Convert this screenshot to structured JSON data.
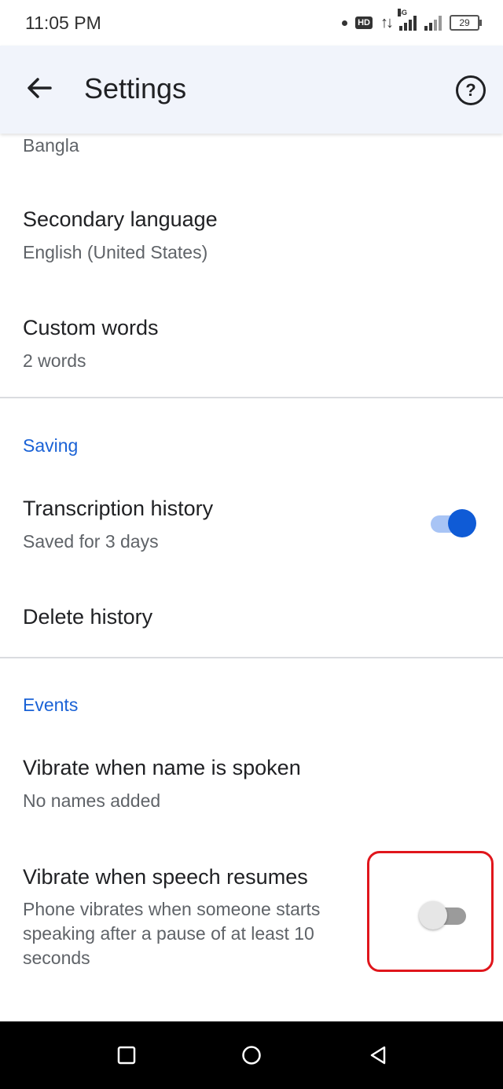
{
  "status_bar": {
    "time": "11:05 PM",
    "hd": "HD",
    "arrows": "↑↓",
    "network": "4G",
    "battery": "29"
  },
  "app_bar": {
    "title": "Settings"
  },
  "items": {
    "primary_language_value": "Bangla",
    "secondary_language_title": "Secondary language",
    "secondary_language_value": "English (United States)",
    "custom_words_title": "Custom words",
    "custom_words_value": "2 words",
    "saving_header": "Saving",
    "transcription_history_title": "Transcription history",
    "transcription_history_value": "Saved for 3 days",
    "transcription_history_on": true,
    "delete_history_title": "Delete history",
    "events_header": "Events",
    "vibrate_name_title": "Vibrate when name is spoken",
    "vibrate_name_value": "No names added",
    "vibrate_speech_title": "Vibrate when speech resumes",
    "vibrate_speech_desc_line1": "Phone vibrates when someone starts",
    "vibrate_speech_desc_line2": "speaking after a pause of at least 10",
    "vibrate_speech_desc_line3": "seconds",
    "vibrate_speech_on": false
  },
  "colors": {
    "accent": "#1a62d6",
    "toggle_on": "#0f5bd6",
    "highlight": "#e0161c"
  },
  "icons": [
    "back-arrow-icon",
    "help-icon",
    "nav-recents-icon",
    "nav-home-icon",
    "nav-back-icon"
  ]
}
